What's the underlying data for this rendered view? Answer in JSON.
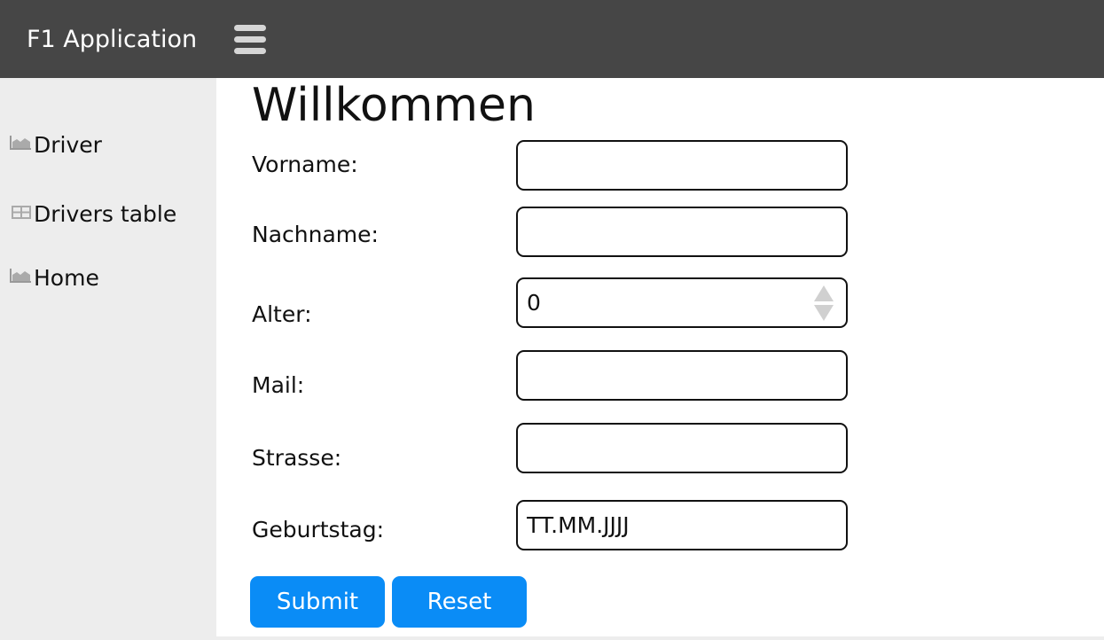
{
  "header": {
    "app_title": "F1 Application",
    "menu_icon": "hamburger-menu-icon",
    "background": "#464646"
  },
  "sidebar": {
    "items": [
      {
        "label": "Driver",
        "icon": "area-chart-icon"
      },
      {
        "label": "Drivers table",
        "icon": "table-icon"
      },
      {
        "label": "Home",
        "icon": "area-chart-icon"
      }
    ]
  },
  "main": {
    "title": "Willkommen",
    "form": {
      "fields": [
        {
          "label": "Vorname:",
          "value": "",
          "placeholder": ""
        },
        {
          "label": "Nachname:",
          "value": "",
          "placeholder": ""
        },
        {
          "label": "Alter:",
          "value": "0",
          "placeholder": ""
        },
        {
          "label": "Mail:",
          "value": "",
          "placeholder": ""
        },
        {
          "label": "Strasse:",
          "value": "",
          "placeholder": ""
        },
        {
          "label": "Geburtstag:",
          "value": "",
          "placeholder": "TT.MM.JJJJ"
        }
      ],
      "submit_label": "Submit",
      "reset_label": "Reset"
    }
  },
  "colors": {
    "accent": "#0a8cf6",
    "sidebar_bg": "#ededed"
  }
}
